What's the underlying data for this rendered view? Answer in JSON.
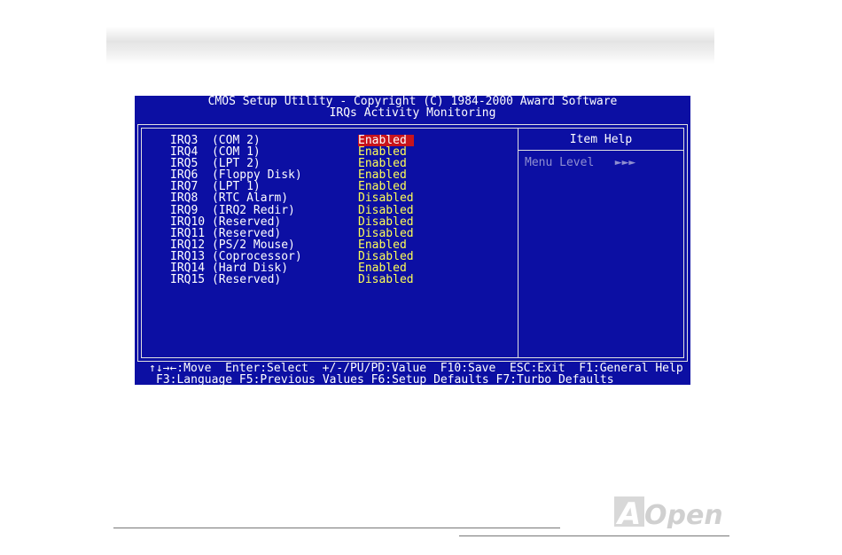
{
  "bios": {
    "title_line1": "CMOS Setup Utility - Copyright (C) 1984-2000 Award Software",
    "title_line2": "IRQs Activity Monitoring",
    "items": [
      {
        "label": "IRQ3  (COM 2)",
        "value": "Enabled",
        "selected": true
      },
      {
        "label": "IRQ4  (COM 1)",
        "value": "Enabled"
      },
      {
        "label": "IRQ5  (LPT 2)",
        "value": "Enabled"
      },
      {
        "label": "IRQ6  (Floppy Disk)",
        "value": "Enabled"
      },
      {
        "label": "IRQ7  (LPT 1)",
        "value": "Enabled"
      },
      {
        "label": "IRQ8  (RTC Alarm)",
        "value": "Disabled"
      },
      {
        "label": "IRQ9  (IRQ2 Redir)",
        "value": "Disabled"
      },
      {
        "label": "IRQ10 (Reserved)",
        "value": "Disabled"
      },
      {
        "label": "IRQ11 (Reserved)",
        "value": "Disabled"
      },
      {
        "label": "IRQ12 (PS/2 Mouse)",
        "value": "Enabled"
      },
      {
        "label": "IRQ13 (Coprocessor)",
        "value": "Disabled"
      },
      {
        "label": "IRQ14 (Hard Disk)",
        "value": "Enabled"
      },
      {
        "label": "IRQ15 (Reserved)",
        "value": "Disabled"
      }
    ],
    "help": {
      "title": "Item Help",
      "menu_level": "Menu Level   ►►►"
    },
    "footer_line1": "↑↓→←:Move  Enter:Select  +/-/PU/PD:Value  F10:Save  ESC:Exit  F1:General Help",
    "footer_line2": "F3:Language F5:Previous Values F6:Setup Defaults F7:Turbo Defaults"
  },
  "brand": {
    "logo_text": "AOpen"
  },
  "colors": {
    "bios_background": "#0c0fa3",
    "value_text": "#ffff55",
    "selection_highlight": "#c8141c",
    "help_text": "#8f8fd0"
  }
}
